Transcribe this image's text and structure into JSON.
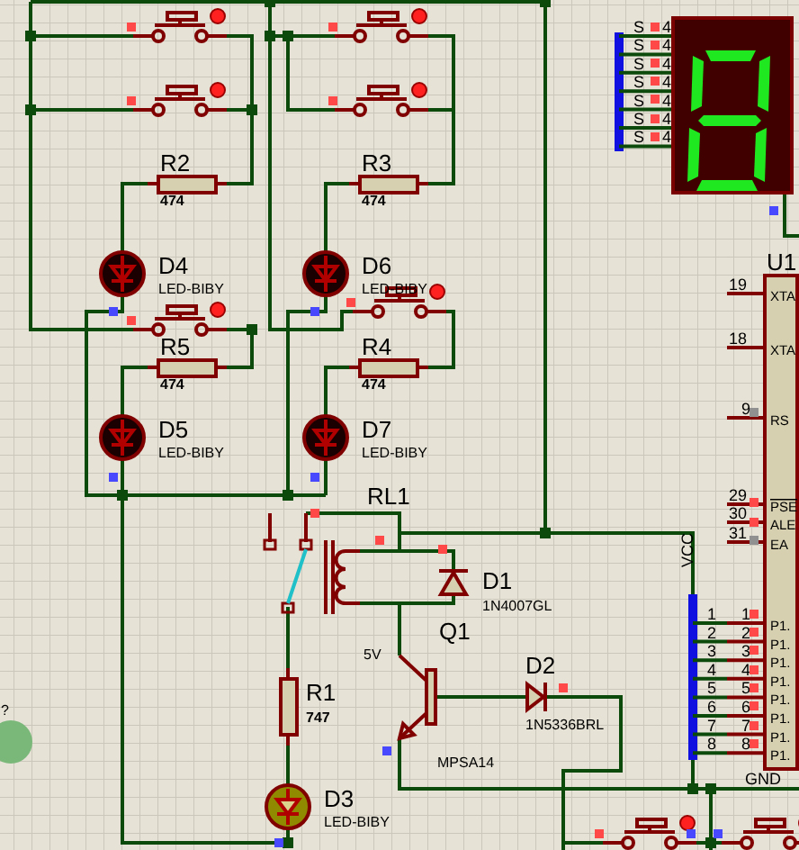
{
  "schematic": {
    "switches": [
      {
        "pressed": false
      },
      {
        "pressed": false
      },
      {
        "pressed": false
      },
      {
        "pressed": false
      },
      {
        "pressed": false
      },
      {
        "pressed": false
      },
      {
        "pressed": false
      },
      {
        "pressed": false
      }
    ],
    "resistors": [
      {
        "ref": "R2",
        "value": "474"
      },
      {
        "ref": "R3",
        "value": "474"
      },
      {
        "ref": "R5",
        "value": "474"
      },
      {
        "ref": "R4",
        "value": "474"
      },
      {
        "ref": "R1",
        "value": "747"
      }
    ],
    "leds": [
      {
        "ref": "D4",
        "value": "LED-BIBY",
        "lit": false
      },
      {
        "ref": "D6",
        "value": "LED-BIBY",
        "lit": false
      },
      {
        "ref": "D5",
        "value": "LED-BIBY",
        "lit": false
      },
      {
        "ref": "D7",
        "value": "LED-BIBY",
        "lit": false
      },
      {
        "ref": "D3",
        "value": "LED-BIBY",
        "lit": true
      }
    ],
    "relay": {
      "ref": "RL1",
      "coil_label": "5V"
    },
    "diodes": [
      {
        "ref": "D1",
        "value": "1N4007GL"
      },
      {
        "ref": "D2",
        "value": "1N5336BRL"
      }
    ],
    "transistor": {
      "ref": "Q1",
      "value": "MPSA14"
    },
    "display": {
      "segments": [
        {
          "on": true
        },
        {
          "on": true
        },
        {
          "on": true
        },
        {
          "on": true
        },
        {
          "on": true
        },
        {
          "on": true
        },
        {
          "on": true
        }
      ],
      "pins": [
        {
          "label_start": "S",
          "label_end": "4"
        },
        {
          "label_start": "S",
          "label_end": "4"
        },
        {
          "label_start": "S",
          "label_end": "4"
        },
        {
          "label_start": "S",
          "label_end": "4"
        },
        {
          "label_start": "S",
          "label_end": "4"
        },
        {
          "label_start": "S",
          "label_end": "4"
        },
        {
          "label_start": "S",
          "label_end": "4"
        }
      ]
    },
    "mcu": {
      "ref": "U1",
      "pins": [
        {
          "number": "19",
          "name": "XTA",
          "active_low": false
        },
        {
          "number": "18",
          "name": "XTA",
          "active_low": false
        },
        {
          "number": "9",
          "name": "RS",
          "active_low": false
        },
        {
          "number": "29",
          "name": "PSE",
          "active_low": true
        },
        {
          "number": "30",
          "name": "ALE",
          "active_low": false
        },
        {
          "number": "31",
          "name": "EA",
          "active_low": false
        },
        {
          "number": "1",
          "name": "P1.",
          "active_low": false
        },
        {
          "number": "2",
          "name": "P1.",
          "active_low": false
        },
        {
          "number": "3",
          "name": "P1.",
          "active_low": false
        },
        {
          "number": "4",
          "name": "P1.",
          "active_low": false
        },
        {
          "number": "5",
          "name": "P1.",
          "active_low": false
        },
        {
          "number": "6",
          "name": "P1.",
          "active_low": false
        },
        {
          "number": "7",
          "name": "P1.",
          "active_low": false
        },
        {
          "number": "8",
          "name": "P1.",
          "active_low": false
        }
      ]
    },
    "bus_labels": [
      "1",
      "2",
      "3",
      "4",
      "5",
      "6",
      "7",
      "8"
    ],
    "net_labels": [
      "VCC",
      "GND"
    ],
    "probe": {
      "label": "?"
    },
    "pin_state_markers": [
      {
        "color": "#ff4848"
      },
      {
        "color": "#ff4848"
      },
      {
        "color": "#4848ff"
      },
      {
        "color": "#ff4848"
      },
      {
        "color": "#4848ff"
      },
      {
        "color": "#ff4848"
      },
      {
        "color": "#ff4848"
      },
      {
        "color": "#ff4848"
      },
      {
        "color": "#4848ff"
      },
      {
        "color": "#4848ff"
      },
      {
        "color": "#ff4848"
      },
      {
        "color": "#ff4848"
      },
      {
        "color": "#ff4848"
      },
      {
        "color": "#ff4848"
      },
      {
        "color": "#ff4848"
      },
      {
        "color": "#ff4848"
      },
      {
        "color": "#ff4848"
      },
      {
        "color": "#4848ff"
      },
      {
        "color": "#909090"
      },
      {
        "color": "#ff4848"
      },
      {
        "color": "#ff4848"
      },
      {
        "color": "#909090"
      },
      {
        "color": "#ff4848"
      },
      {
        "color": "#ff4848"
      },
      {
        "color": "#ff4848"
      },
      {
        "color": "#ff4848"
      },
      {
        "color": "#ff4848"
      },
      {
        "color": "#ff4848"
      },
      {
        "color": "#ff4848"
      },
      {
        "color": "#ff4848"
      },
      {
        "color": "#ff4848"
      },
      {
        "color": "#ff4848"
      },
      {
        "color": "#ff4848"
      },
      {
        "color": "#ff4848"
      },
      {
        "color": "#4848ff"
      },
      {
        "color": "#4848ff"
      },
      {
        "color": "#ff4848"
      },
      {
        "color": "#4848ff"
      },
      {
        "color": "#4848ff"
      }
    ]
  }
}
